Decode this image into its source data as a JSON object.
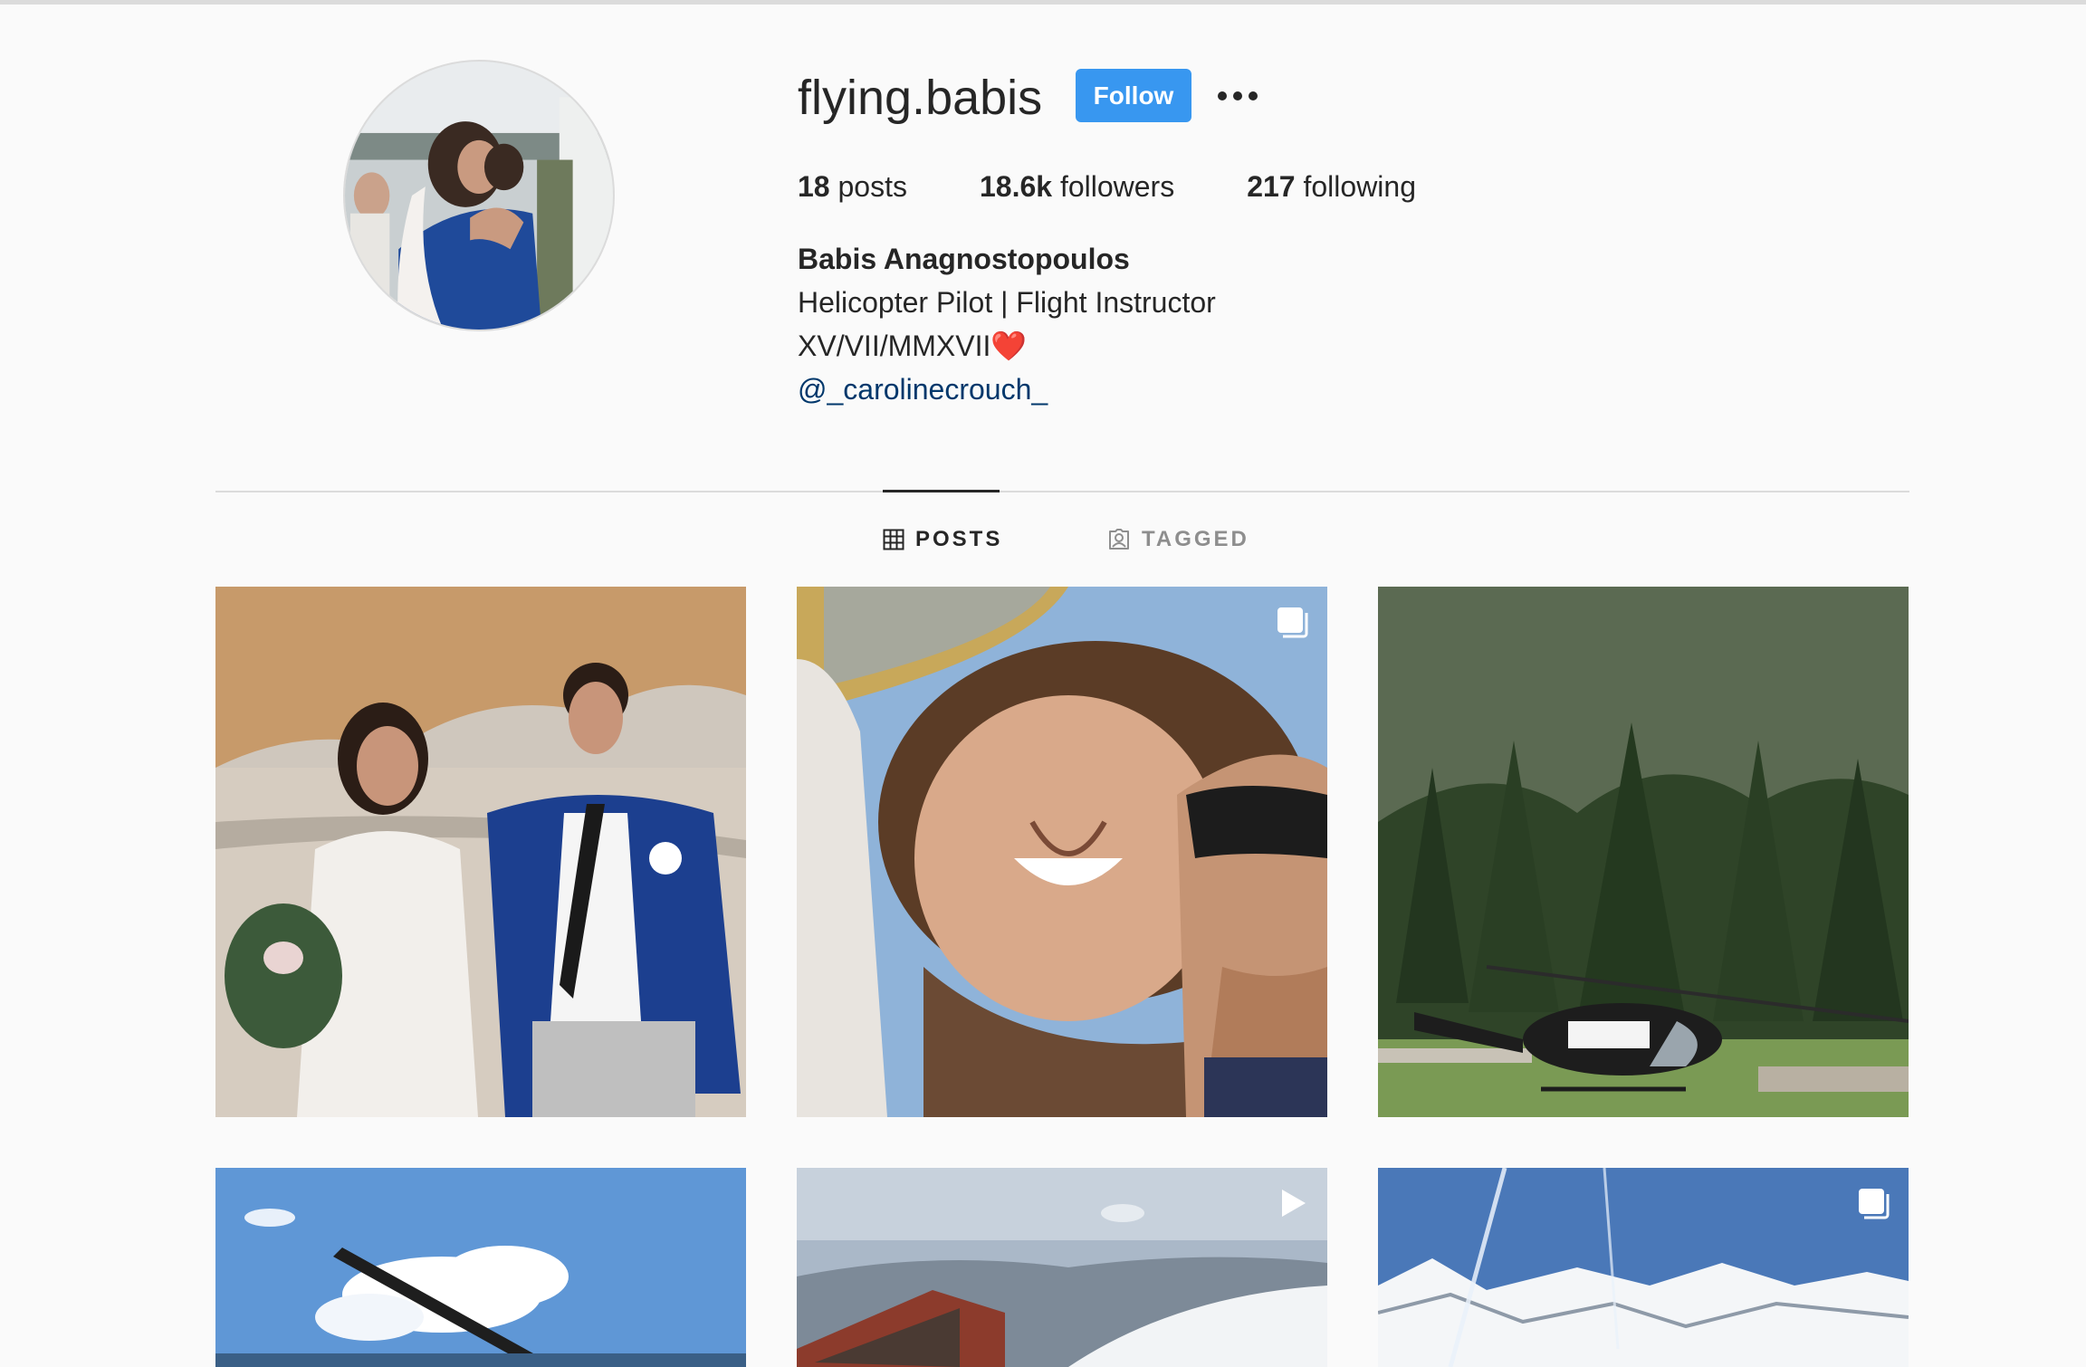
{
  "profile": {
    "username": "flying.babis",
    "follow_label": "Follow",
    "more_icon": "more-horizontal-icon",
    "stats": {
      "posts_count": "18",
      "posts_label": "posts",
      "followers_count": "18.6k",
      "followers_label": "followers",
      "following_count": "217",
      "following_label": "following"
    },
    "bio": {
      "full_name": "Babis Anagnostopoulos",
      "line1": "Helicopter Pilot | Flight Instructor",
      "line2": "XV/VII/MMXVII❤️",
      "mention": "@_carolinecrouch_"
    }
  },
  "tabs": [
    {
      "label": "POSTS",
      "icon": "grid-icon",
      "active": true
    },
    {
      "label": "TAGGED",
      "icon": "tagged-icon",
      "active": false
    }
  ],
  "colors": {
    "accent": "#3897f0",
    "link": "#00376b",
    "muted": "#8e8e8e",
    "background": "#fafafa"
  },
  "posts": [
    {
      "subject": "wedding couple on beach",
      "badge": null
    },
    {
      "subject": "couple selfie",
      "badge": "carousel-icon"
    },
    {
      "subject": "helicopter in forest clearing",
      "badge": null
    },
    {
      "subject": "helicopter rotor and sky",
      "badge": null
    },
    {
      "subject": "snowy mountains view",
      "badge": "video-icon"
    },
    {
      "subject": "snow-covered mountain range",
      "badge": "carousel-icon"
    }
  ]
}
